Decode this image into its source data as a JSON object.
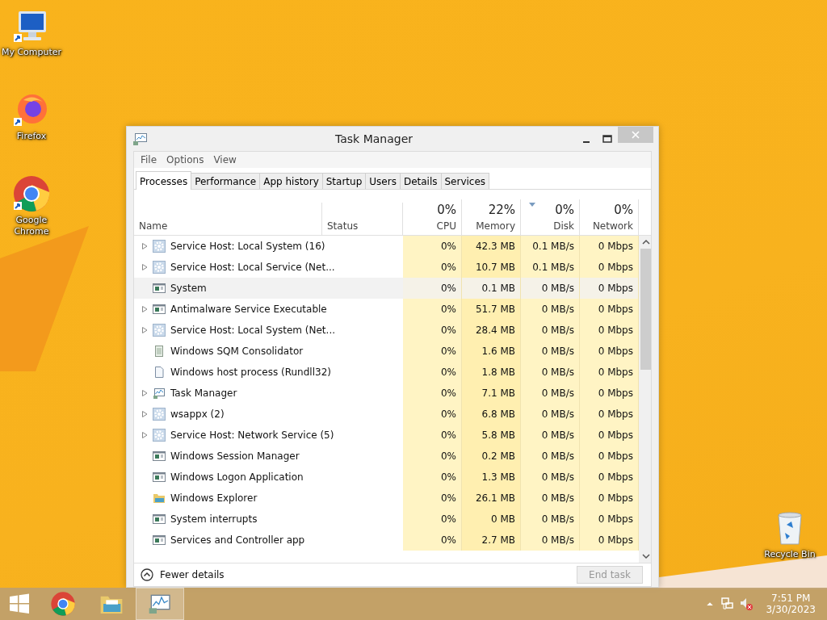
{
  "desktop_icons": [
    {
      "label": "My Computer",
      "kind": "computer"
    },
    {
      "label": "Firefox",
      "kind": "firefox"
    },
    {
      "label": "Google Chrome",
      "kind": "chrome"
    }
  ],
  "recycle_bin": {
    "label": "Recycle Bin"
  },
  "window": {
    "title": "Task Manager",
    "menu": [
      "File",
      "Options",
      "View"
    ],
    "tabs": [
      {
        "label": "Processes",
        "selected": true
      },
      {
        "label": "Performance",
        "selected": false
      },
      {
        "label": "App history",
        "selected": false
      },
      {
        "label": "Startup",
        "selected": false
      },
      {
        "label": "Users",
        "selected": false
      },
      {
        "label": "Details",
        "selected": false
      },
      {
        "label": "Services",
        "selected": false
      }
    ],
    "name_column": "Name",
    "status_column": "Status",
    "metric_columns": [
      {
        "percent": "0%",
        "label": "CPU",
        "sorted": false
      },
      {
        "percent": "22%",
        "label": "Memory",
        "sorted": false
      },
      {
        "percent": "0%",
        "label": "Disk",
        "sorted": true
      },
      {
        "percent": "0%",
        "label": "Network",
        "sorted": false
      }
    ],
    "rows": [
      {
        "name": "Service Host: Local System (16)",
        "kind": "service",
        "expandable": true,
        "selected": false,
        "cpu": "0%",
        "memory": "42.3 MB",
        "disk": "0.1 MB/s",
        "network": "0 Mbps"
      },
      {
        "name": "Service Host: Local Service (Net...",
        "kind": "service",
        "expandable": true,
        "selected": false,
        "cpu": "0%",
        "memory": "10.7 MB",
        "disk": "0.1 MB/s",
        "network": "0 Mbps"
      },
      {
        "name": "System",
        "kind": "app",
        "expandable": false,
        "selected": true,
        "cpu": "0%",
        "memory": "0.1 MB",
        "disk": "0 MB/s",
        "network": "0 Mbps"
      },
      {
        "name": "Antimalware Service Executable",
        "kind": "app",
        "expandable": true,
        "selected": false,
        "cpu": "0%",
        "memory": "51.7 MB",
        "disk": "0 MB/s",
        "network": "0 Mbps"
      },
      {
        "name": "Service Host: Local System (Net...",
        "kind": "service",
        "expandable": true,
        "selected": false,
        "cpu": "0%",
        "memory": "28.4 MB",
        "disk": "0 MB/s",
        "network": "0 Mbps"
      },
      {
        "name": "Windows SQM Consolidator",
        "kind": "list",
        "expandable": false,
        "selected": false,
        "cpu": "0%",
        "memory": "1.6 MB",
        "disk": "0 MB/s",
        "network": "0 Mbps"
      },
      {
        "name": "Windows host process (Rundll32)",
        "kind": "document",
        "expandable": false,
        "selected": false,
        "cpu": "0%",
        "memory": "1.8 MB",
        "disk": "0 MB/s",
        "network": "0 Mbps"
      },
      {
        "name": "Task Manager",
        "kind": "monitor",
        "expandable": true,
        "selected": false,
        "cpu": "0%",
        "memory": "7.1 MB",
        "disk": "0 MB/s",
        "network": "0 Mbps"
      },
      {
        "name": "wsappx (2)",
        "kind": "service",
        "expandable": true,
        "selected": false,
        "cpu": "0%",
        "memory": "6.8 MB",
        "disk": "0 MB/s",
        "network": "0 Mbps"
      },
      {
        "name": "Service Host: Network Service (5)",
        "kind": "service",
        "expandable": true,
        "selected": false,
        "cpu": "0%",
        "memory": "5.8 MB",
        "disk": "0 MB/s",
        "network": "0 Mbps"
      },
      {
        "name": "Windows Session Manager",
        "kind": "app",
        "expandable": false,
        "selected": false,
        "cpu": "0%",
        "memory": "0.2 MB",
        "disk": "0 MB/s",
        "network": "0 Mbps"
      },
      {
        "name": "Windows Logon Application",
        "kind": "app",
        "expandable": false,
        "selected": false,
        "cpu": "0%",
        "memory": "1.3 MB",
        "disk": "0 MB/s",
        "network": "0 Mbps"
      },
      {
        "name": "Windows Explorer",
        "kind": "folder",
        "expandable": false,
        "selected": false,
        "cpu": "0%",
        "memory": "26.1 MB",
        "disk": "0 MB/s",
        "network": "0 Mbps"
      },
      {
        "name": "System interrupts",
        "kind": "app",
        "expandable": false,
        "selected": false,
        "cpu": "0%",
        "memory": "0 MB",
        "disk": "0 MB/s",
        "network": "0 Mbps"
      },
      {
        "name": "Services and Controller app",
        "kind": "app",
        "expandable": false,
        "selected": false,
        "cpu": "0%",
        "memory": "2.7 MB",
        "disk": "0 MB/s",
        "network": "0 Mbps"
      }
    ],
    "fewer_details": "Fewer details",
    "end_task": {
      "label": "End task",
      "disabled": true
    }
  },
  "taskbar": {
    "apps": [
      {
        "kind": "chrome",
        "active": false
      },
      {
        "kind": "folder",
        "active": false
      },
      {
        "kind": "monitor",
        "active": true
      }
    ],
    "time": "7:51 PM",
    "date": "3/30/2023"
  }
}
